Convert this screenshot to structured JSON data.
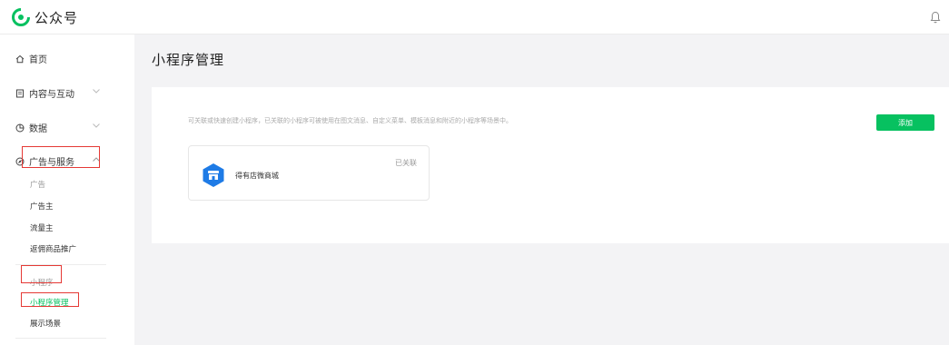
{
  "header": {
    "brand": "公众号",
    "icons": {
      "logo": "wechat-official-account-logo",
      "bell": "bell-icon"
    }
  },
  "sidebar": {
    "home": "首页",
    "content": "内容与互动",
    "data": "数据",
    "ads": "广告与服务",
    "ads_items": [
      "广告",
      "广告主",
      "流量主",
      "返佣商品推广"
    ],
    "mini": "小程序",
    "mini_items": [
      "小程序管理",
      "展示场景"
    ]
  },
  "main": {
    "title": "小程序管理",
    "description": "可关联或快速创建小程序，已关联的小程序可被使用在图文消息、自定义菜单、模板消息和附近的小程序等场景中。",
    "add_button": "添加",
    "miniprogram": {
      "name": "得有店微商城",
      "status": "已关联"
    }
  },
  "colors": {
    "accent": "#07c160",
    "highlight": "#e53935"
  }
}
